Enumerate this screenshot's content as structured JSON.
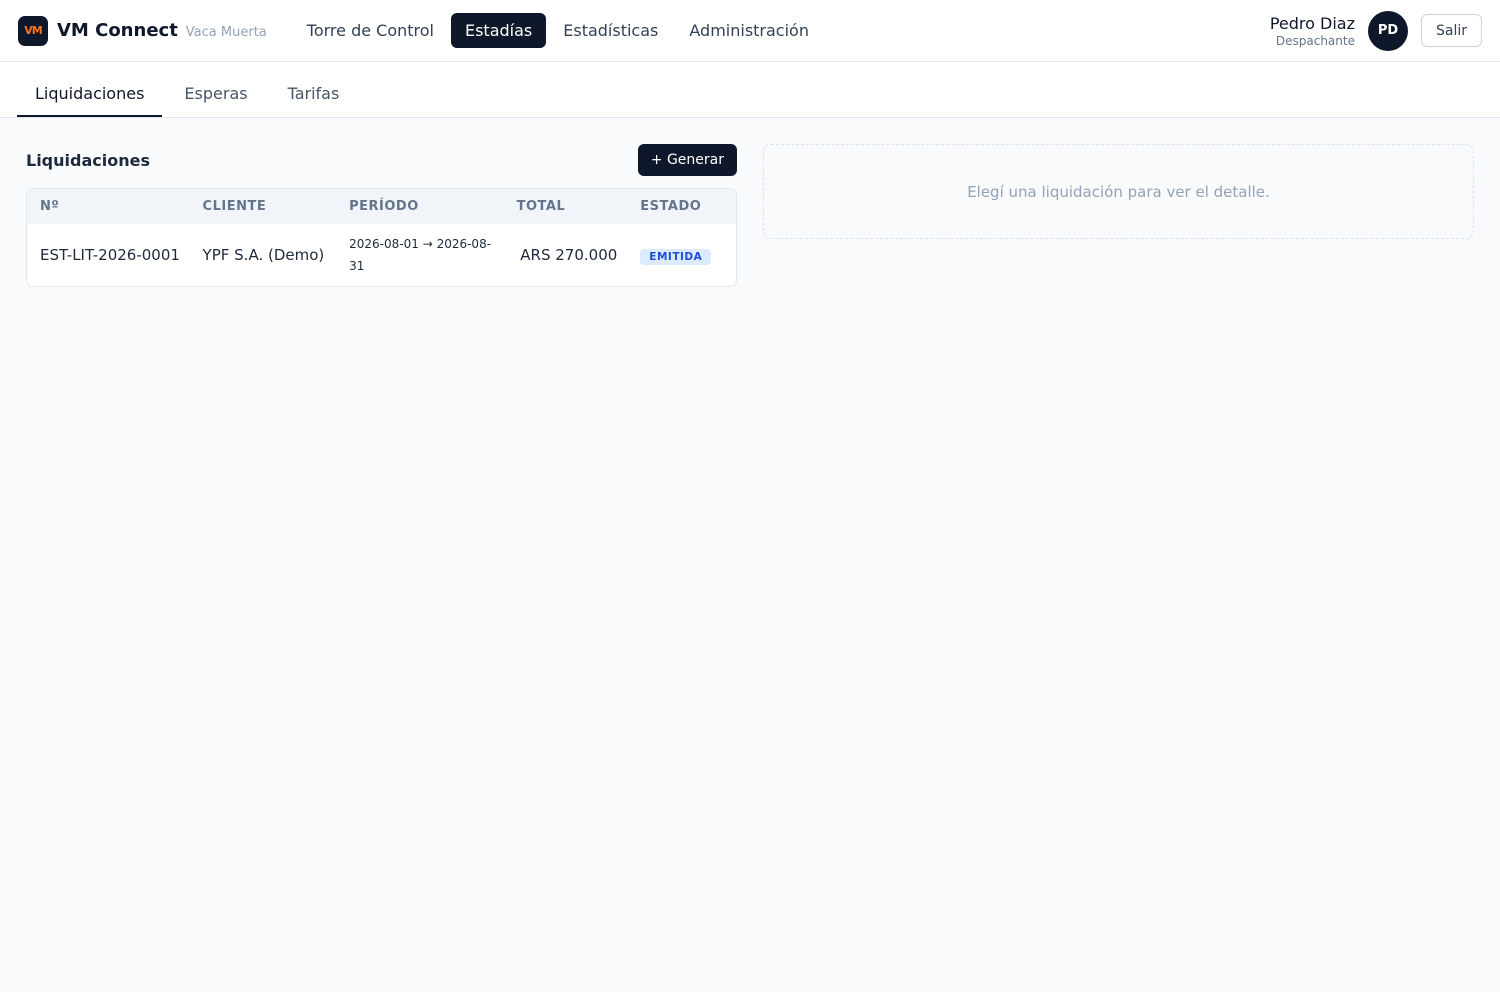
{
  "app": {
    "logo_text": "VM",
    "name": "VM Connect",
    "subtitle": "Vaca Muerta"
  },
  "nav": {
    "items": [
      {
        "label": "Torre de Control",
        "active": false
      },
      {
        "label": "Estadías",
        "active": true
      },
      {
        "label": "Estadísticas",
        "active": false
      },
      {
        "label": "Administración",
        "active": false
      }
    ]
  },
  "user": {
    "name": "Pedro Diaz",
    "role": "Despachante",
    "initials": "PD",
    "logout_label": "Salir"
  },
  "subtabs": {
    "items": [
      {
        "label": "Liquidaciones",
        "active": true
      },
      {
        "label": "Esperas",
        "active": false
      },
      {
        "label": "Tarifas",
        "active": false
      }
    ]
  },
  "liquidaciones": {
    "title": "Liquidaciones",
    "generate_label": "+ Generar",
    "columns": [
      "Nº",
      "CLIENTE",
      "PERÍODO",
      "TOTAL",
      "ESTADO"
    ],
    "rows": [
      {
        "numero": "EST-LIT-2026-0001",
        "cliente": "YPF S.A. (Demo)",
        "periodo": "2026-08-01 → 2026-08-31",
        "total": "ARS 270.000",
        "estado": "EMITIDA"
      }
    ]
  },
  "detail": {
    "empty_message": "Elegí una liquidación para ver el detalle."
  },
  "colors": {
    "primary": "#0f172a",
    "logo_accent": "#f97316",
    "badge_text": "#1d4ed8",
    "badge_bg": "#dbeafe"
  }
}
